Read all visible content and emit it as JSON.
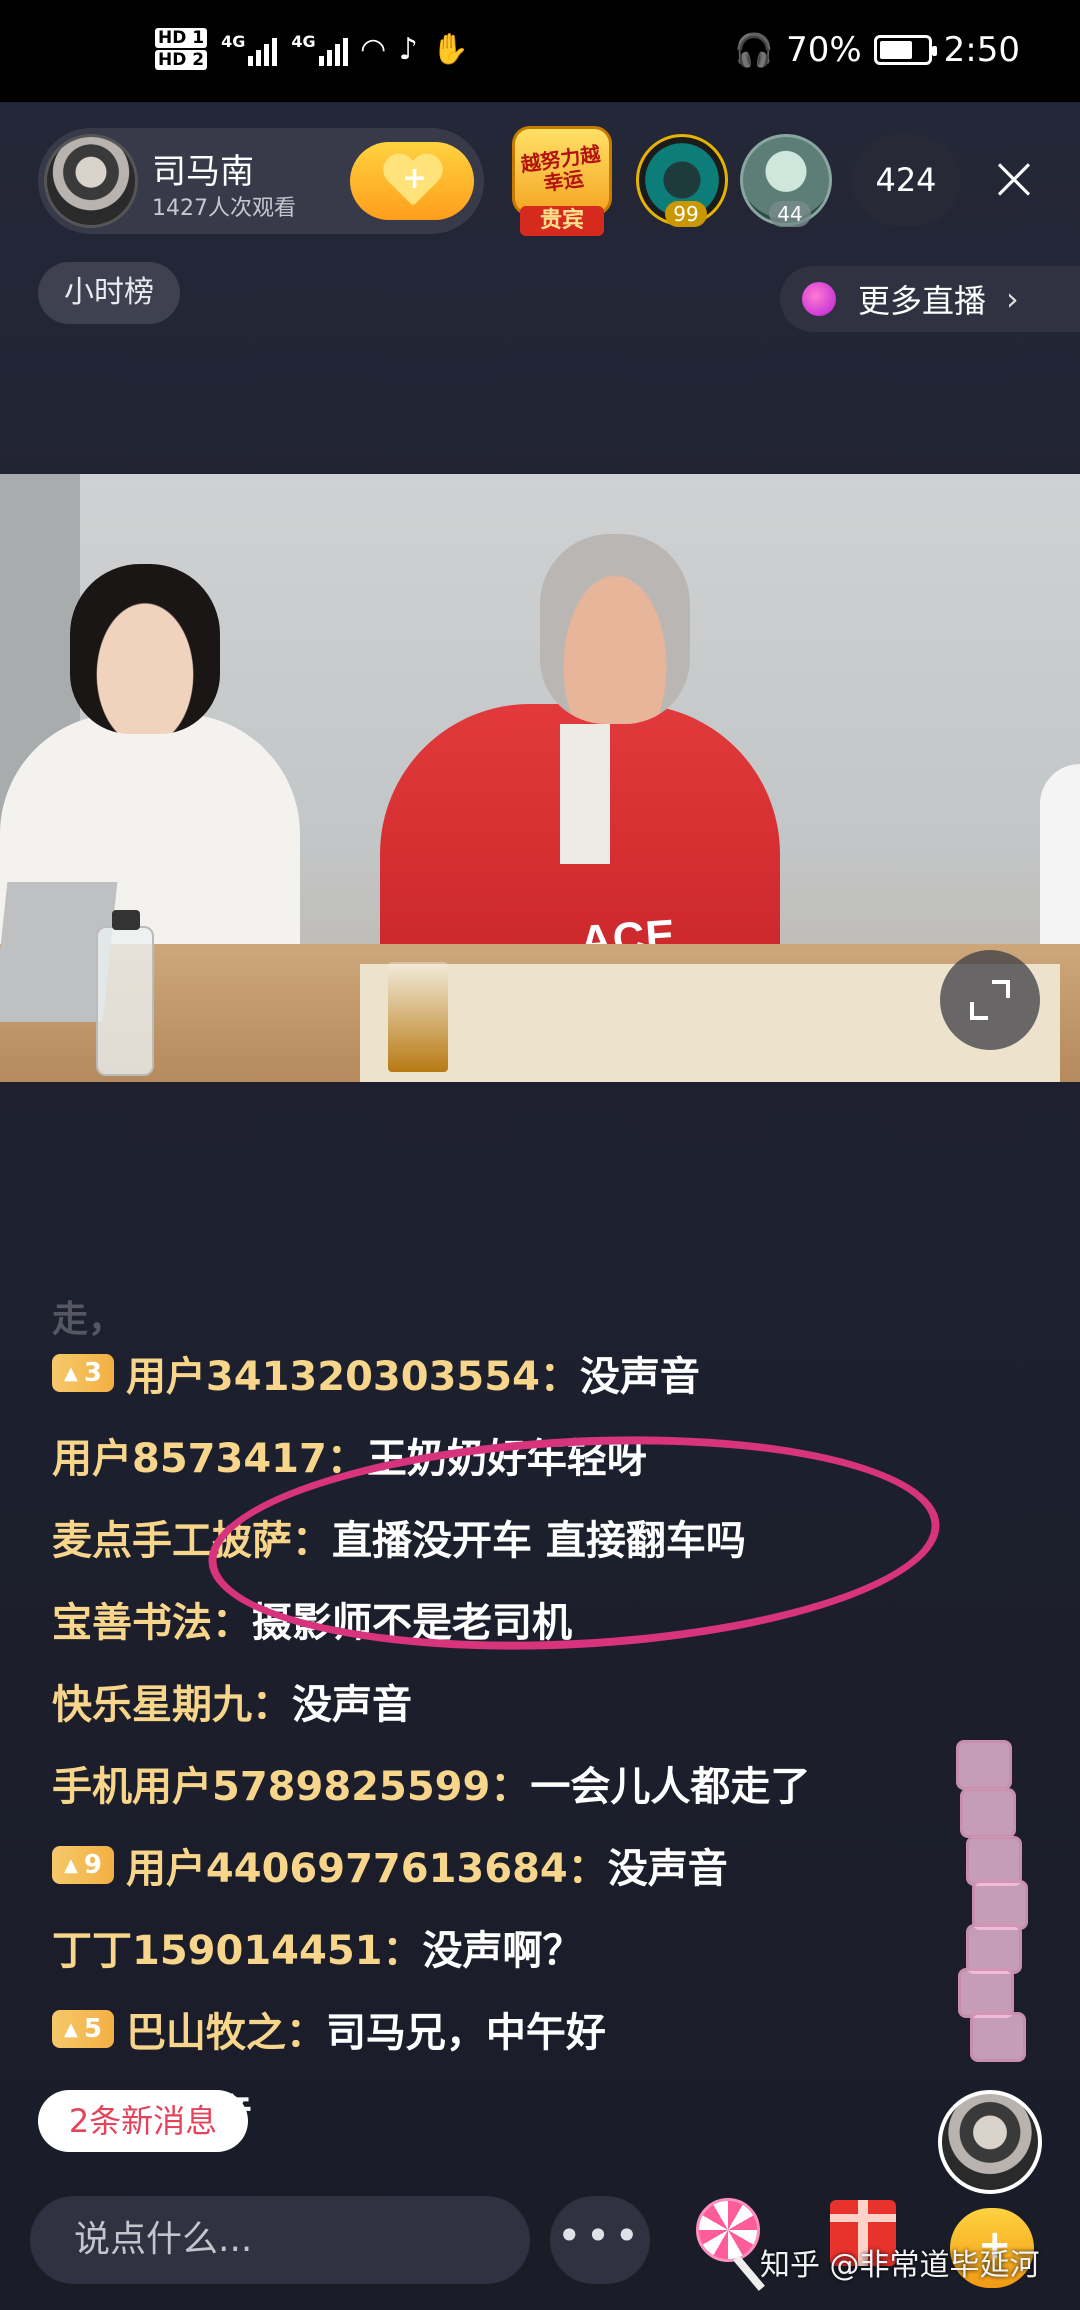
{
  "status_bar": {
    "hd1": "HD 1",
    "hd2": "HD 2",
    "net1": "4G",
    "net2": "4G",
    "battery": "70%",
    "battery_level": 0.7,
    "time": "2:50"
  },
  "header": {
    "host_name": "司马南",
    "viewers_text": "1427人次观看",
    "follow_icon": "heart-plus-icon",
    "vip_badge_text": "越努力越幸运",
    "vip_badge_label": "贵宾",
    "top_viewers": [
      {
        "count": "99"
      },
      {
        "count": "44"
      }
    ],
    "online_count": "424",
    "close_icon": "close-icon"
  },
  "hour_rank_label": "小时榜",
  "more_live_label": "更多直播",
  "video": {
    "jacket_text": "ACE",
    "fullscreen_icon": "expand-icon"
  },
  "chat": {
    "faded_top": "走，",
    "messages": [
      {
        "level": "3",
        "user": "用户341320303554：",
        "text": "没声音"
      },
      {
        "level": "",
        "user": "用户8573417：",
        "text": "王奶奶好年轻呀"
      },
      {
        "level": "",
        "user": "麦点手工披萨：",
        "text": "直播没开车 直接翻车吗"
      },
      {
        "level": "",
        "user": "宝善书法：",
        "text": "摄影师不是老司机"
      },
      {
        "level": "",
        "user": "快乐星期九：",
        "text": "没声音"
      },
      {
        "level": "",
        "user": "手机用户5789825599：",
        "text": "一会儿人都走了"
      },
      {
        "level": "9",
        "user": "用户4406977613684：",
        "text": "没声音"
      },
      {
        "level": "",
        "user": "丁丁159014451：",
        "text": "没声啊？"
      },
      {
        "level": "5",
        "user": "巴山牧之：",
        "text": "司马兄，中午好"
      },
      {
        "level": "",
        "user": "：",
        "text": "没有声音"
      }
    ],
    "annotation_color": "#d8337d"
  },
  "new_messages_label": "2条新消息",
  "bottom_bar": {
    "input_placeholder": "说点什么...",
    "more_label": "•••"
  },
  "watermark": "知乎 @非常道毕延河",
  "colors": {
    "username": "#f7d58b",
    "message": "#ffffff",
    "level_badge": "#f3b043",
    "accent_gold": "#ffb52a"
  }
}
